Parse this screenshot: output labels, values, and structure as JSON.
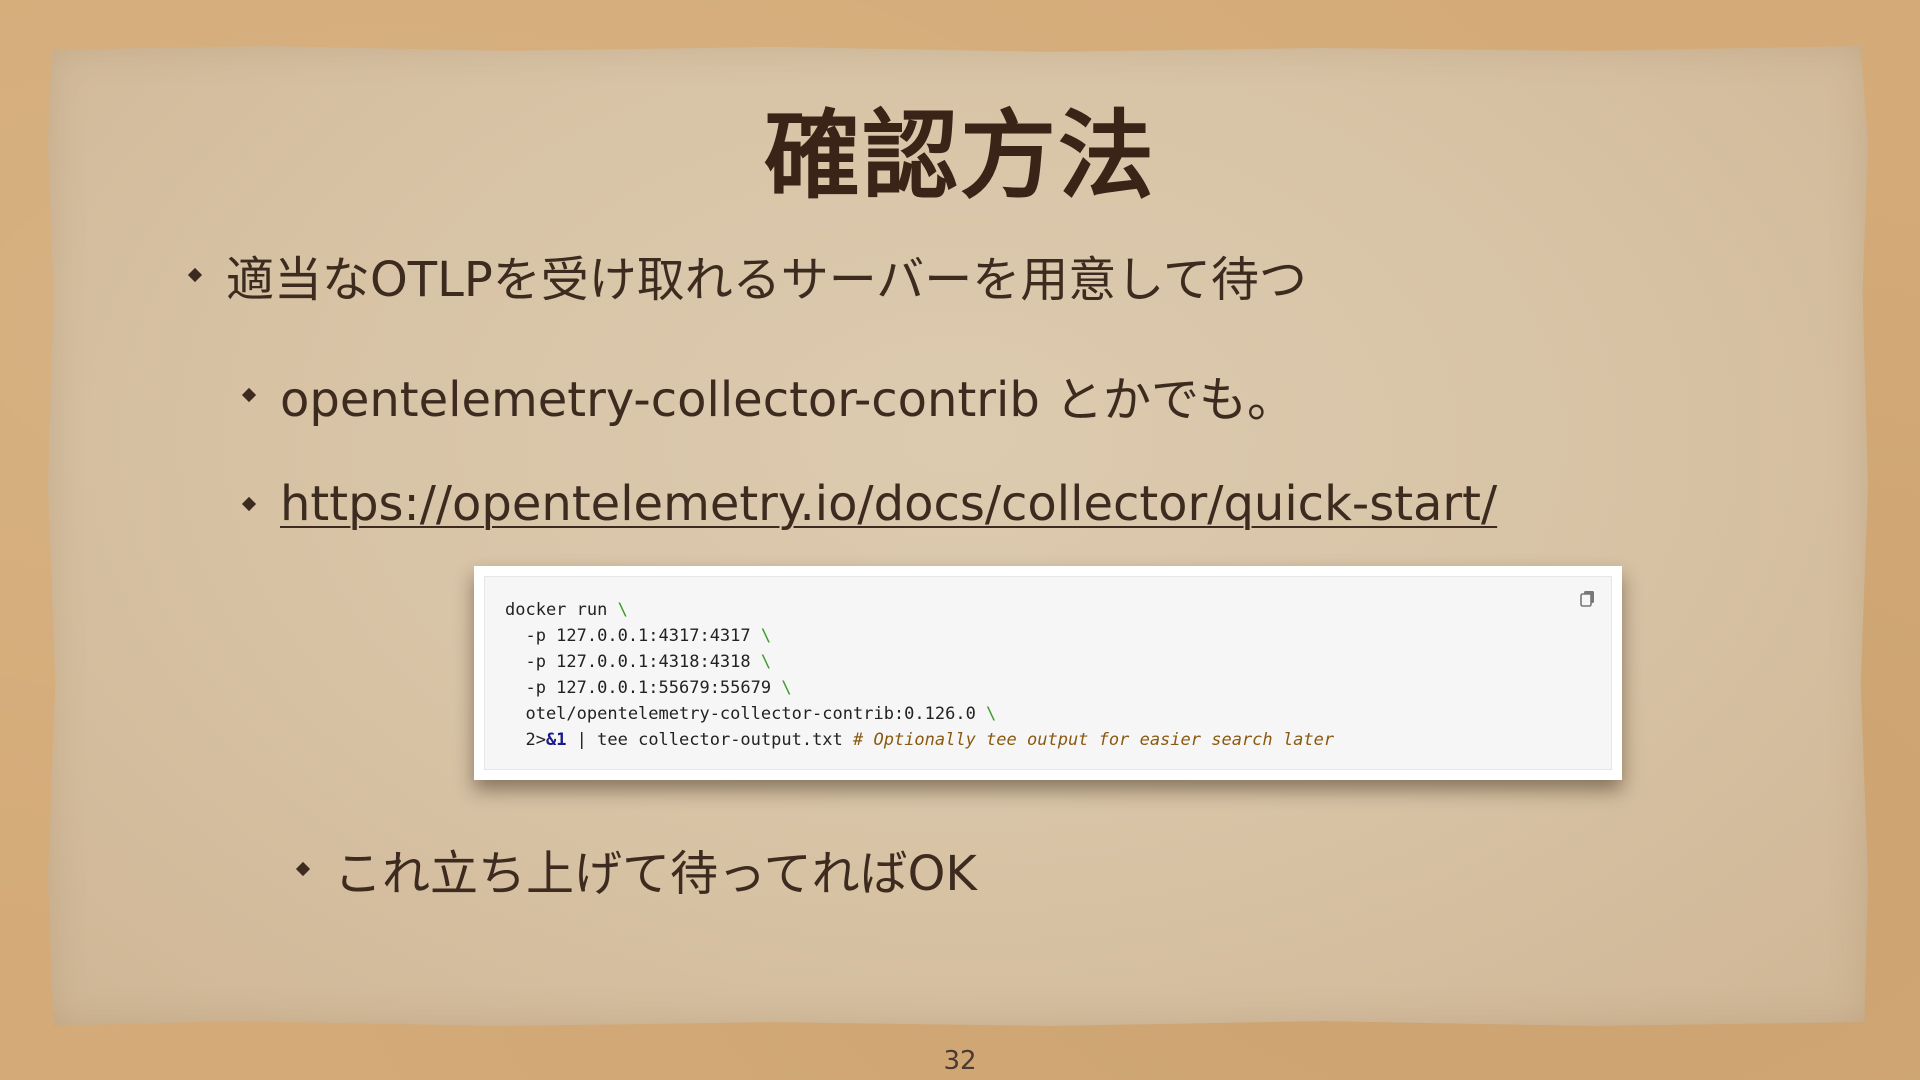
{
  "slide": {
    "title": "確認方法",
    "page_number": "32"
  },
  "bullets": [
    {
      "text": "適当なOTLPを受け取れるサーバーを用意して待つ"
    },
    {
      "text": "opentelemetry-collector-contrib とかでも。"
    },
    {
      "text": "https://opentelemetry.io/docs/collector/quick-start/"
    },
    {
      "text": "これ立ち上げて待ってればOK"
    }
  ],
  "code": {
    "line1": "docker run",
    "line2": "  -p 127.0.0.1:4317:4317",
    "line3": "  -p 127.0.0.1:4318:4318",
    "line4": "  -p 127.0.0.1:55679:55679",
    "line5": "  otel/opentelemetry-collector-contrib:0.126.0",
    "line6_a": "  2>",
    "line6_b": "&1",
    "line6_c": " | tee collector-output.txt ",
    "line6_comment": "# Optionally tee output for easier search later",
    "continuation": " \\",
    "copy_icon": "copy-icon"
  },
  "colors": {
    "background": "#d4ab78",
    "paper": "#d7c2a4",
    "text": "#3d2b20",
    "code_continuation": "#3a9a2a",
    "code_comment": "#8a5a10"
  }
}
